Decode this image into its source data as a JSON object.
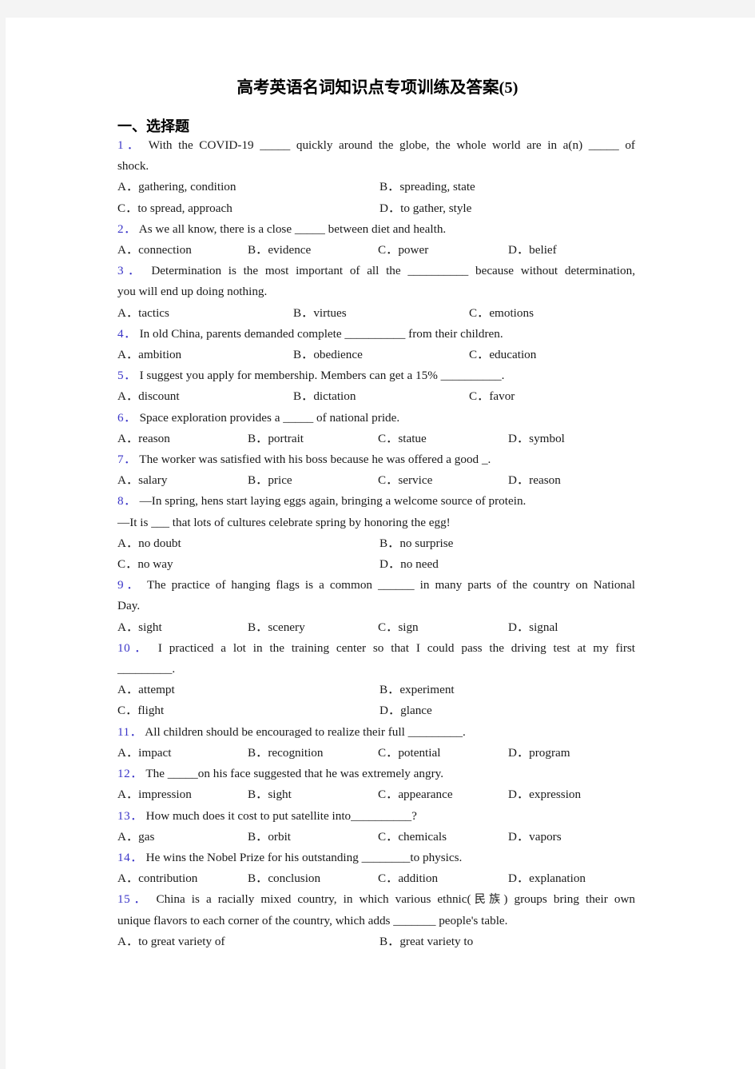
{
  "page": {
    "title": "高考英语名词知识点专项训练及答案(5)",
    "section_heading": "一、选择题",
    "number_color": "#3b36c8",
    "text_color": "#1a1a1a",
    "background": "#ffffff",
    "margin_color": "#f4f4f4"
  },
  "questions": [
    {
      "num": "1．",
      "stem_line1": "With the COVID-19 _____ quickly around the globe, the whole world are in a(n) _____ of",
      "stem_line2": "shock.",
      "layout": "2col",
      "options": [
        "A．gathering, condition",
        "B．spreading, state",
        "C．to spread, approach",
        "D．to gather, style"
      ]
    },
    {
      "num": "2．",
      "stem_line1": "As we all know, there is a close _____ between diet and health.",
      "stem_line2": "",
      "layout": "4col",
      "options": [
        "A．connection",
        "B．evidence",
        "C．power",
        "D．belief"
      ]
    },
    {
      "num": "3．",
      "stem_line1": "Determination is the most important of all the __________ because without determination,",
      "stem_line2": "you will end up doing nothing.",
      "layout": "3col",
      "options": [
        "A．tactics",
        "B．virtues",
        "C．emotions"
      ]
    },
    {
      "num": "4．",
      "stem_line1": "In old China, parents demanded complete __________ from their children.",
      "stem_line2": "",
      "layout": "3col",
      "options": [
        "A．ambition",
        "B．obedience",
        "C．education"
      ]
    },
    {
      "num": "5．",
      "stem_line1": "I suggest you apply for membership. Members can get a 15% __________.",
      "stem_line2": "",
      "layout": "3col",
      "options": [
        "A．discount",
        "B．dictation",
        "C．favor"
      ]
    },
    {
      "num": "6．",
      "stem_line1": "Space exploration provides a _____ of national pride.",
      "stem_line2": "",
      "layout": "4col",
      "options": [
        "A．reason",
        "B．portrait",
        "C．statue",
        "D．symbol"
      ]
    },
    {
      "num": "7．",
      "stem_line1": "The worker was satisfied with his boss because he was offered a good  _.",
      "stem_line2": "",
      "layout": "4col",
      "options": [
        "A．salary",
        "B．price",
        "C．service",
        "D．reason"
      ]
    },
    {
      "num": "8．",
      "stem_line1": "—In spring, hens start laying eggs again, bringing a welcome source of protein.",
      "stem_line2": "—It is ___ that lots of cultures celebrate spring by honoring the egg!",
      "layout": "2col",
      "options": [
        "A．no doubt",
        "B．no surprise",
        "C．no way",
        "D．no need"
      ]
    },
    {
      "num": "9．",
      "stem_line1": "The practice of hanging flags is a common ______ in many parts of the country on National",
      "stem_line2": "Day.",
      "layout": "4col",
      "options": [
        "A．sight",
        "B．scenery",
        "C．sign",
        "D．signal"
      ]
    },
    {
      "num": "10．",
      "stem_line1": "I practiced a lot in the training center so that I could pass the driving test at my first",
      "stem_line2": "_________.",
      "layout": "2col",
      "options": [
        "A．attempt",
        "B．experiment",
        "C．flight",
        "D．glance"
      ]
    },
    {
      "num": "11．",
      "stem_line1": "All children should be encouraged to realize their full _________.",
      "stem_line2": "",
      "layout": "4col",
      "options": [
        "A．impact",
        "B．recognition",
        "C．potential",
        "D．program"
      ]
    },
    {
      "num": "12．",
      "stem_line1": "The _____on his face suggested that he was extremely angry.",
      "stem_line2": "",
      "layout": "4col",
      "options": [
        "A．impression",
        "B．sight",
        "C．appearance",
        "D．expression"
      ]
    },
    {
      "num": "13．",
      "stem_line1": "How much does it cost to put satellite into__________?",
      "stem_line2": "",
      "layout": "4col",
      "options": [
        "A．gas",
        "B．orbit",
        "C．chemicals",
        "D．vapors"
      ]
    },
    {
      "num": "14．",
      "stem_line1": "He wins the Nobel Prize for his outstanding ________to physics.",
      "stem_line2": "",
      "layout": "4col",
      "options": [
        "A．contribution",
        "B．conclusion",
        "C．addition",
        "D．explanation"
      ]
    },
    {
      "num": "15．",
      "stem_line1": "China is a racially mixed country, in which various ethnic(民族) groups bring their own",
      "stem_line2": "unique flavors to each corner of the country, which adds _______ people's table.",
      "layout": "2col",
      "options": [
        "A．to great variety of",
        "B．great variety to"
      ]
    }
  ]
}
